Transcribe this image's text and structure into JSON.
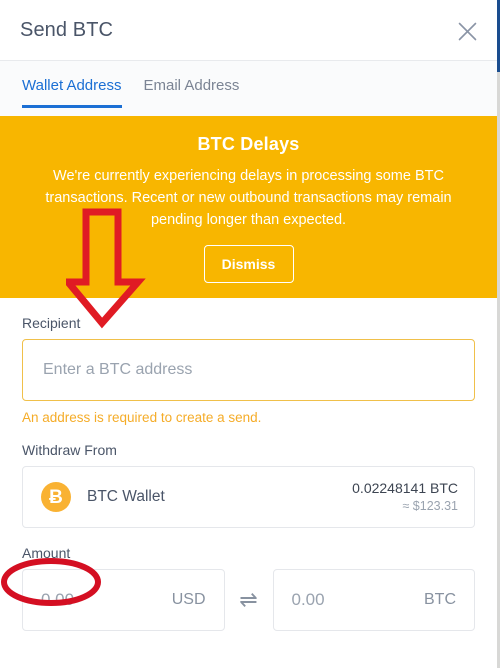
{
  "header": {
    "title": "Send BTC",
    "close_icon": "close-icon"
  },
  "tabs": [
    {
      "label": "Wallet Address",
      "active": true
    },
    {
      "label": "Email Address",
      "active": false
    }
  ],
  "banner": {
    "title": "BTC Delays",
    "message": "We're currently experiencing delays in processing some BTC transactions. Recent or new outbound transactions may remain pending longer than expected.",
    "dismiss_label": "Dismiss",
    "background_color": "#f8b600",
    "text_color": "#ffffff"
  },
  "recipient": {
    "label": "Recipient",
    "placeholder": "Enter a BTC address",
    "value": "",
    "helper_text": "An address is required to create a send.",
    "helper_color": "#f5ac28",
    "border_color": "#f0c04a"
  },
  "withdraw_from": {
    "label": "Withdraw From",
    "wallet_icon": "bitcoin-icon",
    "wallet_glyph": "Ƀ",
    "wallet_name": "BTC Wallet",
    "balance_crypto": "0.02248141 BTC",
    "balance_fiat": "≈ $123.31",
    "icon_color": "#f9b233"
  },
  "amount": {
    "label": "Amount",
    "fiat": {
      "placeholder": "0.00",
      "value": "",
      "currency": "USD"
    },
    "crypto": {
      "placeholder": "0.00",
      "value": "",
      "currency": "BTC"
    },
    "swap_icon": "swap-arrows-icon",
    "swap_glyph": "⇌"
  },
  "annotations": {
    "arrow": {
      "name": "red-down-arrow-annotation",
      "color": "#e01b24"
    },
    "ellipse": {
      "name": "red-ellipse-annotation",
      "color": "#d40f22"
    }
  },
  "theme": {
    "accent_blue": "#1b6fd4",
    "warning_amber": "#f8b600",
    "text_gray": "#4a5568",
    "muted_gray": "#9aa3af"
  }
}
